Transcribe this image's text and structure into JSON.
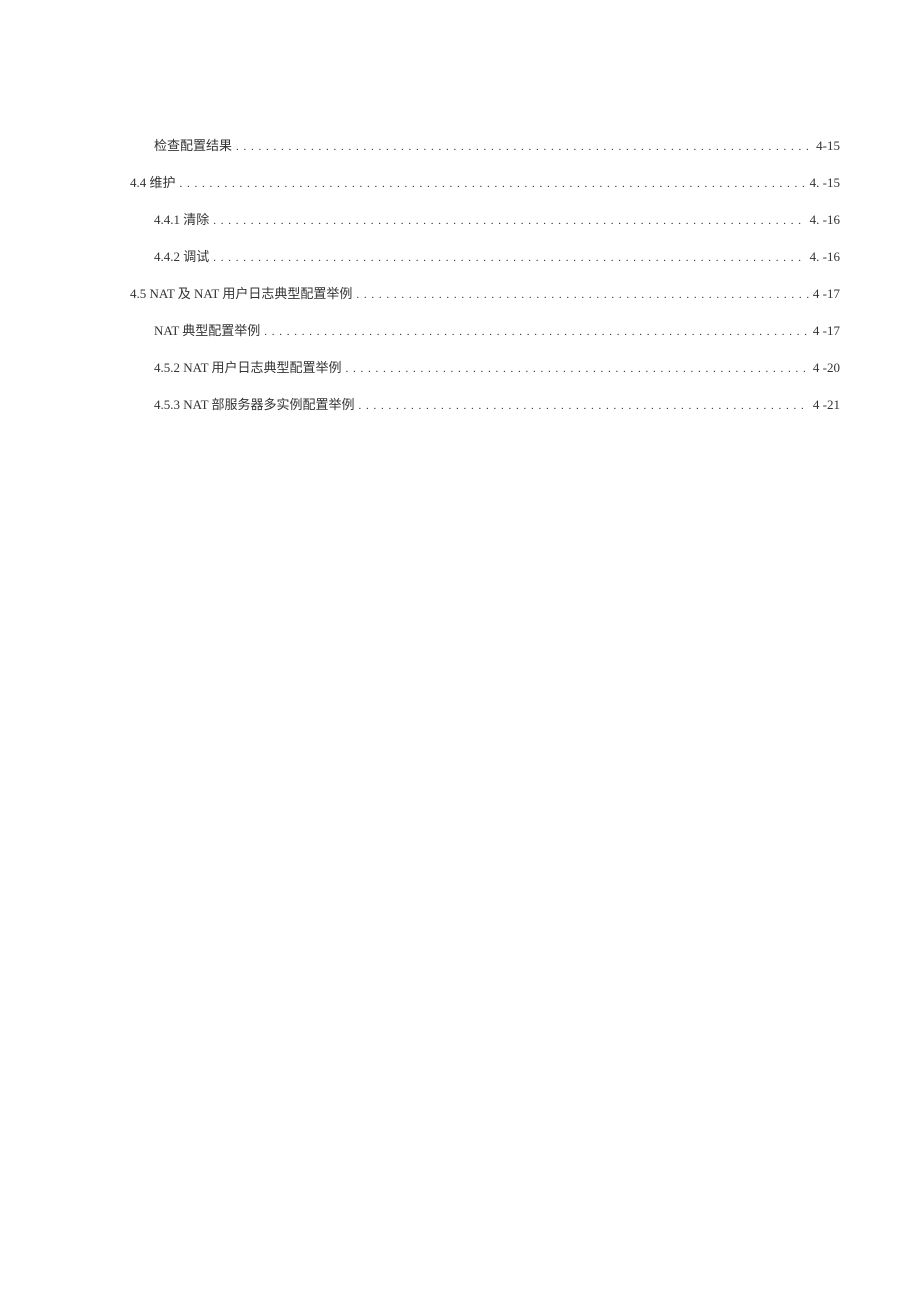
{
  "toc": {
    "entries": [
      {
        "title": "检查配置结果",
        "page": "4-15",
        "indent": 1
      },
      {
        "title": "4.4 维护",
        "page": "4. -15",
        "indent": 0
      },
      {
        "title": "4.4.1  清除",
        "page": "4. -16",
        "indent": 1
      },
      {
        "title": "4.4.2  调试",
        "page": "4. -16",
        "indent": 1
      },
      {
        "title": "4.5  NAT 及 NAT 用户日志典型配置举例",
        "page": "4 -17",
        "indent": 0
      },
      {
        "title": "NAT 典型配置举例",
        "page": "4 -17",
        "indent": 1
      },
      {
        "title": "4.5.2  NAT 用户日志典型配置举例",
        "page": "4 -20",
        "indent": 1
      },
      {
        "title": "4.5.3  NAT 部服务器多实例配置举例",
        "page": "4 -21",
        "indent": 1
      }
    ]
  }
}
